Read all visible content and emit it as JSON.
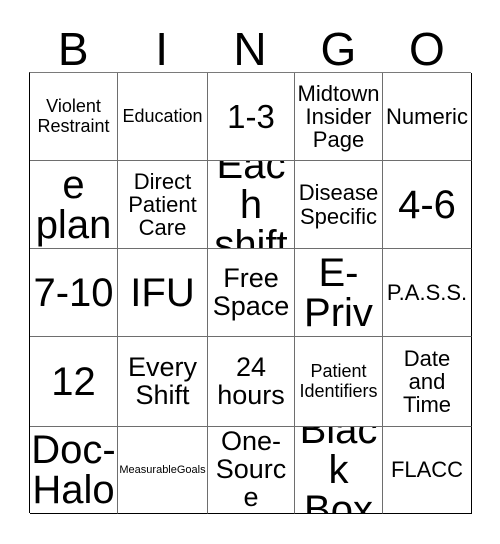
{
  "card": {
    "type": "bingo-card",
    "header_letters": [
      "B",
      "I",
      "N",
      "G",
      "O"
    ],
    "grid_size": "5x5",
    "free_space": "Free Space",
    "colors": {
      "background": "#ffffff",
      "text": "#000000",
      "grid_line": "#6e6e6e",
      "grid_outer": "#000000"
    },
    "rows": [
      [
        {
          "text": "Violent Restraint",
          "size": "t-sm"
        },
        {
          "text": "Education",
          "size": "t-sm"
        },
        {
          "text": "1-3",
          "size": "t-xl"
        },
        {
          "text": "Midtown Insider Page",
          "size": "t-md"
        },
        {
          "text": "Numeric",
          "size": "t-md"
        }
      ],
      [
        {
          "text": "Care plans",
          "size": "t-xxl"
        },
        {
          "text": "Direct Patient Care",
          "size": "t-md"
        },
        {
          "text": "Each shift",
          "size": "t-xxl"
        },
        {
          "text": "Disease Specific",
          "size": "t-md"
        },
        {
          "text": "4-6",
          "size": "t-xxl"
        }
      ],
      [
        {
          "text": "7-10",
          "size": "t-xxl"
        },
        {
          "text": "IFU",
          "size": "t-xxl"
        },
        {
          "text": "Free Space",
          "size": "t-lg"
        },
        {
          "text": "E-Priv",
          "size": "t-xxl"
        },
        {
          "text": "P.A.S.S.",
          "size": "t-md"
        }
      ],
      [
        {
          "text": "12",
          "size": "t-xxl"
        },
        {
          "text": "Every Shift",
          "size": "t-lg"
        },
        {
          "text": "24 hours",
          "size": "t-lg"
        },
        {
          "text": "Patient Identifiers",
          "size": "t-sm"
        },
        {
          "text": "Date and Time",
          "size": "t-md"
        }
      ],
      [
        {
          "text": "Doc-Halo",
          "size": "t-xxl"
        },
        {
          "text": "MeasurableGoals",
          "size": "t-xs"
        },
        {
          "text": "One-Source",
          "size": "t-lg"
        },
        {
          "text": "Black Box",
          "size": "t-xxl"
        },
        {
          "text": "FLACC",
          "size": "t-md"
        }
      ]
    ]
  }
}
